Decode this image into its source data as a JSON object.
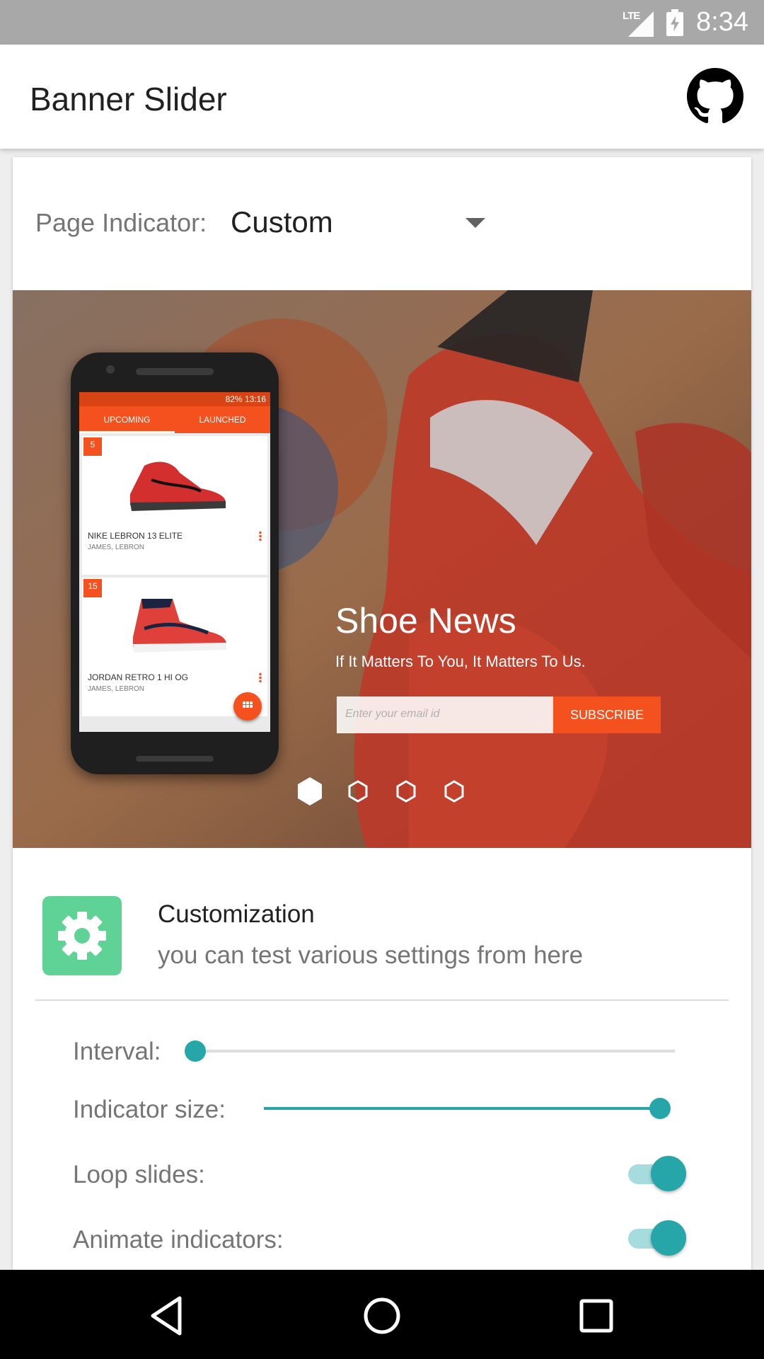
{
  "status_bar": {
    "network": "LTE",
    "time": "8:34",
    "battery_icon": "battery-charging-icon",
    "signal_icon": "signal-icon"
  },
  "app_bar": {
    "title": "Banner Slider",
    "action_icon": "github-icon"
  },
  "indicator_selector": {
    "label": "Page Indicator:",
    "value": "Custom"
  },
  "banner": {
    "title": "Shoe News",
    "subtitle": "If It Matters To You, It Matters To Us.",
    "email_placeholder": "Enter your email id",
    "subscribe_label": "SUBSCRIBE",
    "active_index": 0,
    "indicator_count": 4,
    "accent_color": "#f4511e",
    "phone_mock": {
      "status": "82% 13:16",
      "tabs": [
        "UPCOMING",
        "LAUNCHED"
      ],
      "items": [
        {
          "badge": "5",
          "name": "NIKE LEBRON 13 ELITE",
          "sub": "JAMES, LEBRON"
        },
        {
          "badge": "15",
          "name": "JORDAN RETRO 1 HI OG",
          "sub": "JAMES, LEBRON"
        }
      ]
    }
  },
  "customization": {
    "icon": "gear-icon",
    "icon_color": "#5fd395",
    "title": "Customization",
    "subtitle": "you can test various settings from here"
  },
  "settings": {
    "interval_label": "Interval:",
    "interval_value": 0.0,
    "indicator_size_label": "Indicator size:",
    "indicator_size_value": 1.0,
    "loop_slides_label": "Loop slides:",
    "loop_slides_on": true,
    "animate_indicators_label": "Animate indicators:",
    "animate_indicators_on": true,
    "accent_color": "#26a6a9"
  },
  "nav_bar": {
    "back_icon": "back-icon",
    "home_icon": "home-icon",
    "recents_icon": "recents-icon"
  }
}
